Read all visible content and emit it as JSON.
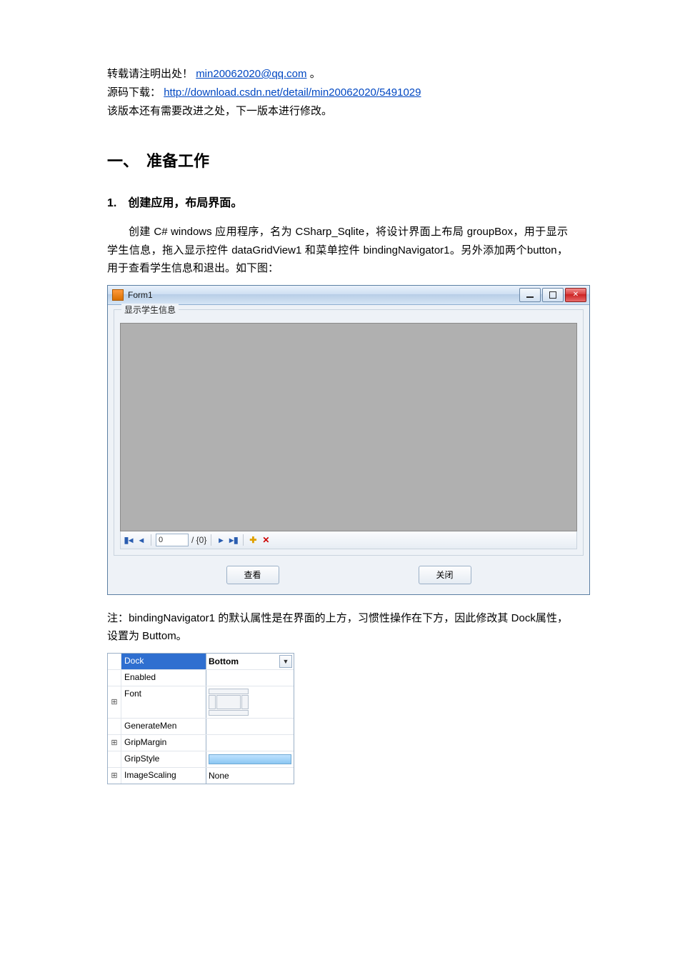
{
  "intro": {
    "line1_prefix": "转载请注明出处！",
    "email": "min20062020@qq.com",
    "line1_suffix": "。",
    "line2_prefix": "源码下载：",
    "download_url": "http://download.csdn.net/detail/min20062020/5491029",
    "line3": "该版本还有需要改进之处，下一版本进行修改。"
  },
  "section1_title": "一、　准备工作",
  "sub1_title": "1.　创建应用，布局界面。",
  "para1": "创建 C# windows 应用程序，名为 CSharp_Sqlite，将设计界面上布局 groupBox，用于显示学生信息，拖入显示控件 dataGridView1 和菜单控件 bindingNavigator1。另外添加两个button，用于查看学生信息和退出。如下图：",
  "form1": {
    "title": "Form1",
    "groupbox_legend": "显示学生信息",
    "nav": {
      "position": "0",
      "count_format": "/ {0}"
    },
    "btn_view": "查看",
    "btn_close": "关闭"
  },
  "note": "注：bindingNavigator1 的默认属性是在界面的上方，习惯性操作在下方，因此修改其 Dock属性，设置为 Buttom。",
  "propgrid": {
    "rows": [
      {
        "expand": "",
        "name": "Dock",
        "value": "Bottom",
        "selected": true,
        "dropdown": true
      },
      {
        "expand": "",
        "name": "Enabled",
        "value": ""
      },
      {
        "expand": "⊞",
        "name": "Font",
        "value": "",
        "dock_editor": true
      },
      {
        "expand": "",
        "name": "GenerateMen",
        "value": ""
      },
      {
        "expand": "⊞",
        "name": "GripMargin",
        "value": ""
      },
      {
        "expand": "",
        "name": "GripStyle",
        "value": "",
        "gripbar": true
      },
      {
        "expand": "⊞",
        "name": "ImageScaling",
        "value": "None"
      }
    ]
  }
}
